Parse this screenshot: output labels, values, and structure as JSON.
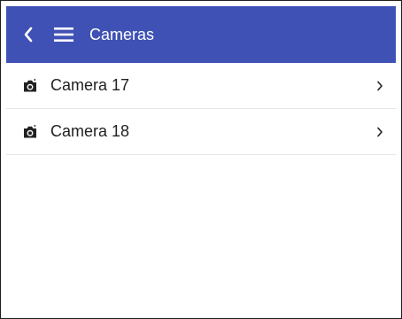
{
  "app_bar": {
    "title": "Cameras",
    "back_icon": "back-chevron-icon",
    "menu_icon": "hamburger-menu-icon",
    "color": "#3f51b5"
  },
  "cameras": [
    {
      "label": "Camera 17",
      "icon": "camera-icon",
      "trailing_icon": "chevron-right-icon"
    },
    {
      "label": "Camera 18",
      "icon": "camera-icon",
      "trailing_icon": "chevron-right-icon"
    }
  ]
}
